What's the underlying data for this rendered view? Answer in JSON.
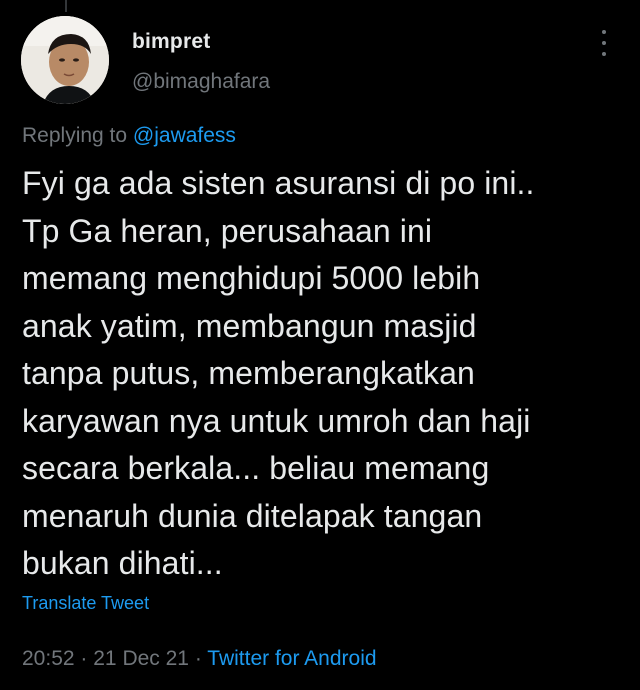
{
  "tweet": {
    "display_name": "bimpret",
    "handle": "@bimaghafara",
    "replying_prefix": "Replying to",
    "replying_to": "@jawafess",
    "text": "Fyi ga ada sisten asuransi di po ini..\nTp Ga heran, perusahaan ini\nmemang menghidupi 5000 lebih\nanak yatim, membangun masjid\ntanpa putus, memberangkatkan\nkaryawan nya untuk umroh dan haji\nsecara berkala... beliau memang\nmenaruh dunia ditelapak tangan\nbukan dihati...",
    "translate_label": "Translate Tweet",
    "time": "20:52",
    "separator": "·",
    "date": "21 Dec 21",
    "source": "Twitter for Android"
  },
  "icons": {
    "avatar": "avatar-photo",
    "more": "more-vertical-icon"
  },
  "colors": {
    "background": "#000000",
    "primary_text": "#e7e9ea",
    "secondary_text": "#71767b",
    "accent": "#1d9bf0"
  }
}
